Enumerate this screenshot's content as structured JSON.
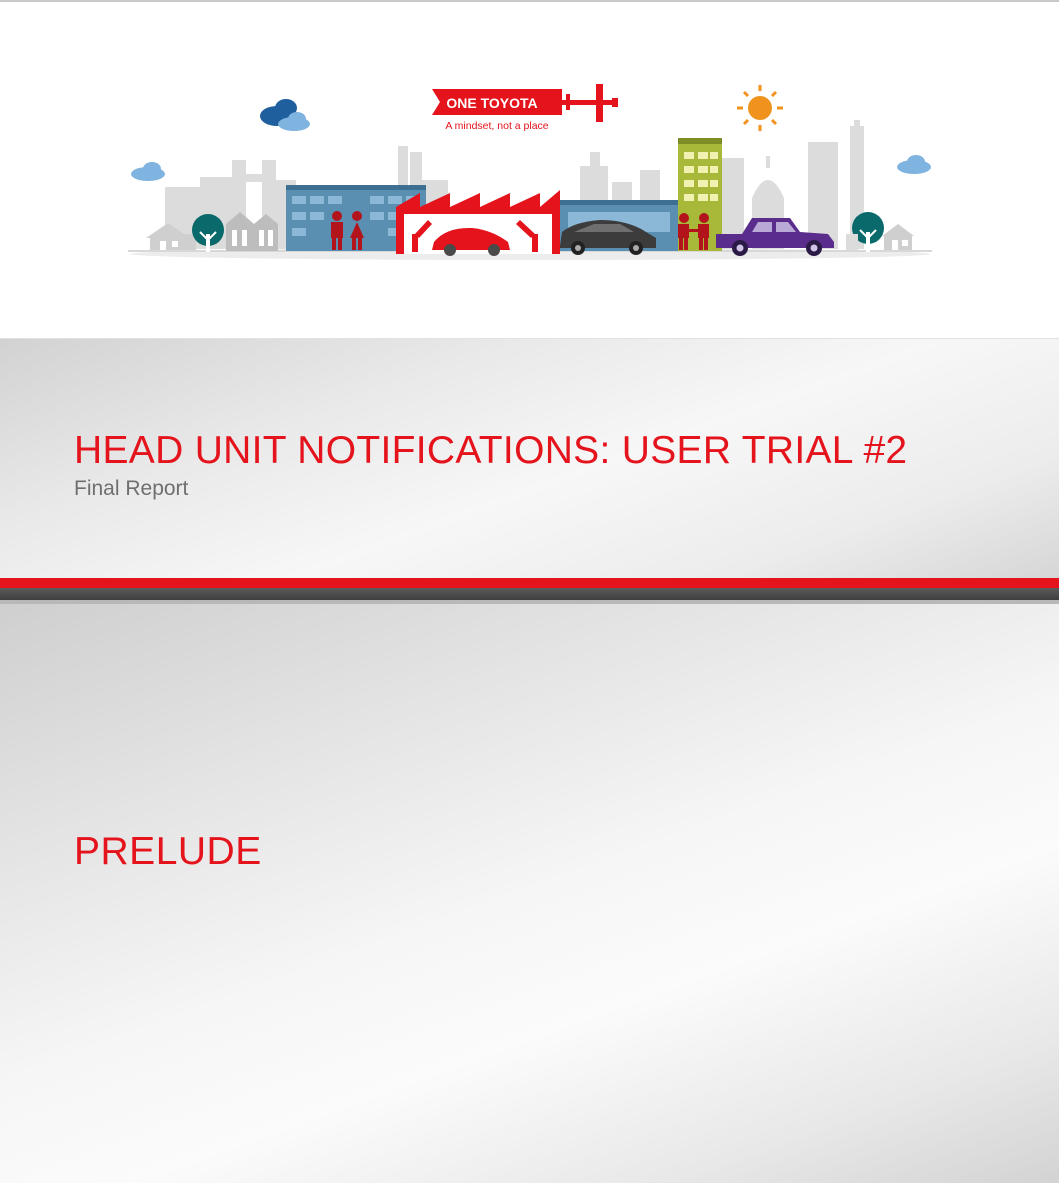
{
  "banner": {
    "brand": "ONE TOYOTA",
    "tagline": "A mindset, not a place"
  },
  "title_slide": {
    "title": "HEAD UNIT NOTIFICATIONS: USER TRIAL #2",
    "subtitle": "Final Report"
  },
  "section_slide": {
    "title": "PRELUDE"
  },
  "colors": {
    "accent_red": "#e4131c",
    "dark_band": "#4a4a4a",
    "subtitle_gray": "#6f6f6f"
  }
}
